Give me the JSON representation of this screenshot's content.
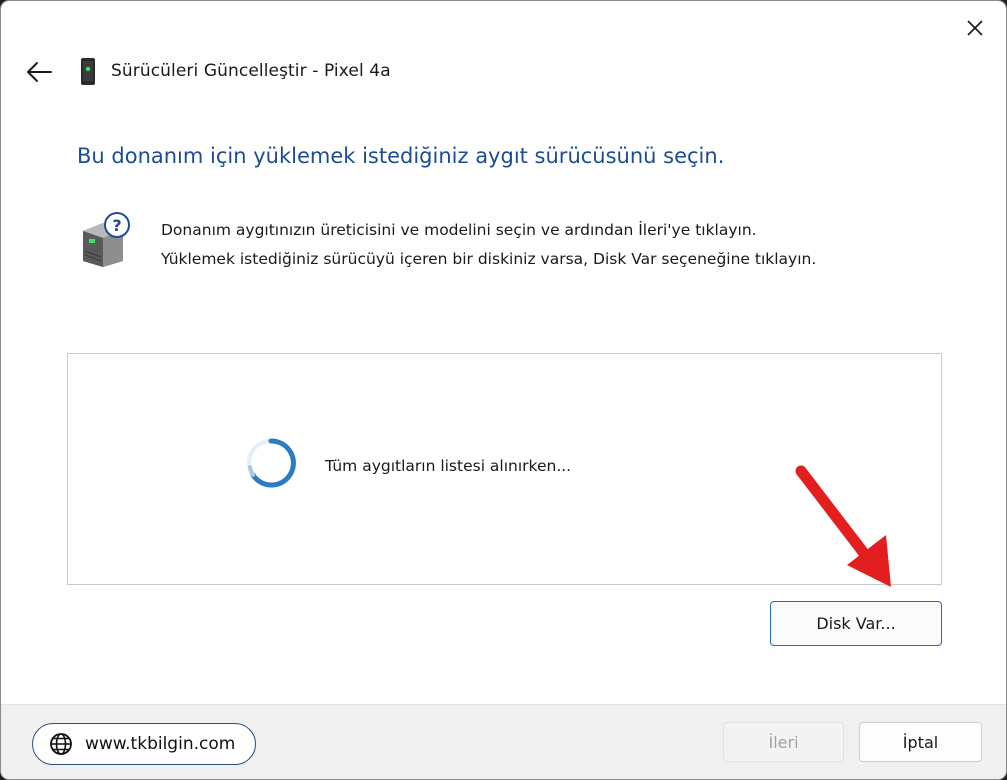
{
  "window": {
    "title": "Sürücüleri Güncelleştir - Pixel 4a",
    "heading": "Bu donanım için yüklemek istediğiniz aygıt sürücüsünü seçin.",
    "instructions": [
      "Donanım aygıtınızın üreticisini ve modelini seçin ve ardından İleri'ye tıklayın.",
      "Yüklemek istediğiniz sürücüyü içeren bir diskiniz varsa, Disk Var seçeneğine tıklayın."
    ]
  },
  "device_list": {
    "loading_text": "Tüm aygıtların listesi alınırken...",
    "spinner_icon": "loading-spinner-icon"
  },
  "buttons": {
    "disk": "Disk Var...",
    "next": "İleri",
    "cancel": "İptal"
  },
  "watermark": {
    "site": "www.tkbilgin.com",
    "icon": "globe-icon"
  },
  "icons": {
    "close": "close-icon",
    "back": "back-arrow-icon",
    "device": "phone-device-icon",
    "help_drive": "drive-question-icon",
    "annotation": "red-arrow-icon"
  },
  "colors": {
    "heading": "#1c4d94",
    "accent": "#1b6ec2",
    "annotation_arrow": "#e31e1e",
    "footer_bg": "#f0f0f0"
  }
}
